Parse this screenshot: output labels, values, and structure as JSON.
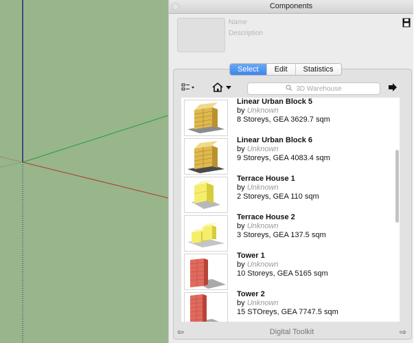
{
  "panel": {
    "title": "Components",
    "name_placeholder": "Name",
    "description_placeholder": "Description",
    "tabs": [
      {
        "label": "Select",
        "active": true
      },
      {
        "label": "Edit",
        "active": false
      },
      {
        "label": "Statistics",
        "active": false
      }
    ],
    "search_placeholder": "3D Warehouse",
    "collection_name": "Digital Toolkit",
    "items": [
      {
        "title": "Linear Urban Block 5",
        "author_prefix": "by",
        "author": "Unknown",
        "desc": "8 Storeys, GEA 3629.7 sqm",
        "thumb": "urban-block-thumbnail"
      },
      {
        "title": "Linear Urban Block 6",
        "author_prefix": "by",
        "author": "Unknown",
        "desc": "9 Storeys, GEA 4083.4 sqm",
        "thumb": "urban-block-thumbnail"
      },
      {
        "title": "Terrace House 1",
        "author_prefix": "by",
        "author": "Unknown",
        "desc": "2 Storeys, GEA 110 sqm",
        "thumb": "terrace-house-thumbnail"
      },
      {
        "title": "Terrace House 2",
        "author_prefix": "by",
        "author": "Unknown",
        "desc": "3 Storeys, GEA 137.5 sqm",
        "thumb": "terrace-house-thumbnail"
      },
      {
        "title": "Tower 1",
        "author_prefix": "by",
        "author": "Unknown",
        "desc": "10 Storeys, GEA 5165 sqm",
        "thumb": "tower-thumbnail"
      },
      {
        "title": "Tower 2",
        "author_prefix": "by",
        "author": "Unknown",
        "desc": "15 STOreys, GEA 7747.5 sqm",
        "thumb": "tower-thumbnail"
      }
    ]
  },
  "icons": {
    "view_options": "view-options-icon",
    "home": "home-icon",
    "search": "search-icon",
    "details": "details-arrow-icon",
    "back": "back-arrow-icon",
    "forward": "forward-arrow-icon",
    "save": "save-icon"
  },
  "colors": {
    "viewport": "#98b58c",
    "select_tab": "#3d86ec",
    "axis_green": "#1f9e3a",
    "axis_red": "#b3382a",
    "axis_blue": "#1d2a7a"
  }
}
